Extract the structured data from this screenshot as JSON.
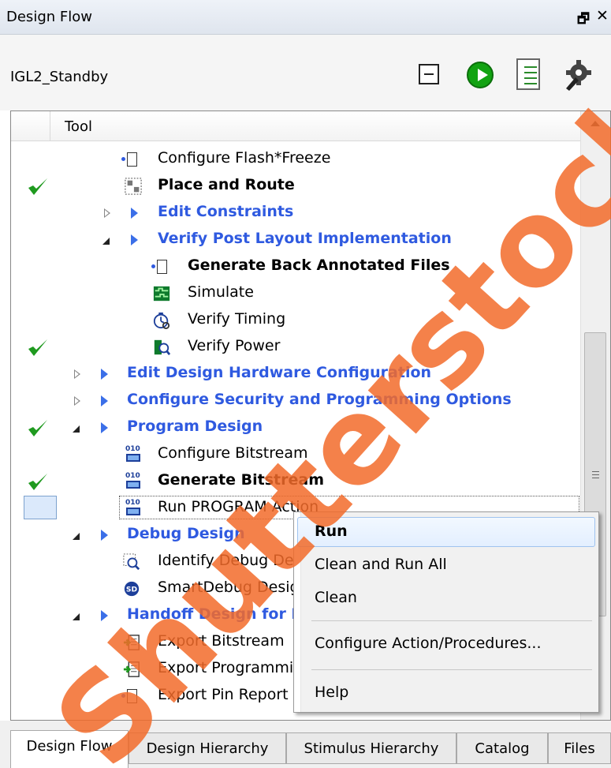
{
  "window": {
    "title": "Design Flow",
    "float_glyph": "🗗",
    "close_glyph": "✕"
  },
  "project": {
    "name": "IGL2_Standby"
  },
  "toolbar": {
    "icons": [
      "collapse-all-icon",
      "run-icon",
      "report-icon",
      "options-gear-icon"
    ]
  },
  "tree": {
    "column_header": "Tool",
    "rows": [
      {
        "label": "Configure Flash*Freeze"
      },
      {
        "label": "Place and Route"
      },
      {
        "label": "Edit Constraints"
      },
      {
        "label": "Verify Post Layout Implementation"
      },
      {
        "label": "Generate Back Annotated Files"
      },
      {
        "label": "Simulate"
      },
      {
        "label": "Verify Timing"
      },
      {
        "label": "Verify Power"
      },
      {
        "label": "Edit Design Hardware Configuration"
      },
      {
        "label": "Configure Security and Programming Options"
      },
      {
        "label": "Program Design"
      },
      {
        "label": "Configure Bitstream"
      },
      {
        "label": "Generate Bitstream"
      },
      {
        "label": "Run PROGRAM Action"
      },
      {
        "label": "Debug Design"
      },
      {
        "label": "Identify Debug Design"
      },
      {
        "label": "SmartDebug Design"
      },
      {
        "label": "Handoff Design for Production"
      },
      {
        "label": "Export Bitstream"
      },
      {
        "label": "Export Programming Job"
      },
      {
        "label": "Export Pin Report"
      }
    ]
  },
  "context_menu": {
    "items": [
      "Run",
      "Clean and Run All",
      "Clean",
      "Configure Action/Procedures...",
      "Help"
    ]
  },
  "tabs": [
    "Design Flow",
    "Design Hierarchy",
    "Stimulus Hierarchy",
    "Catalog",
    "Files"
  ],
  "colors": {
    "link_blue": "#2f5ae0",
    "check_green": "#1f9a1f",
    "watermark": "#f26b2a"
  },
  "watermark": "Shutterstock"
}
